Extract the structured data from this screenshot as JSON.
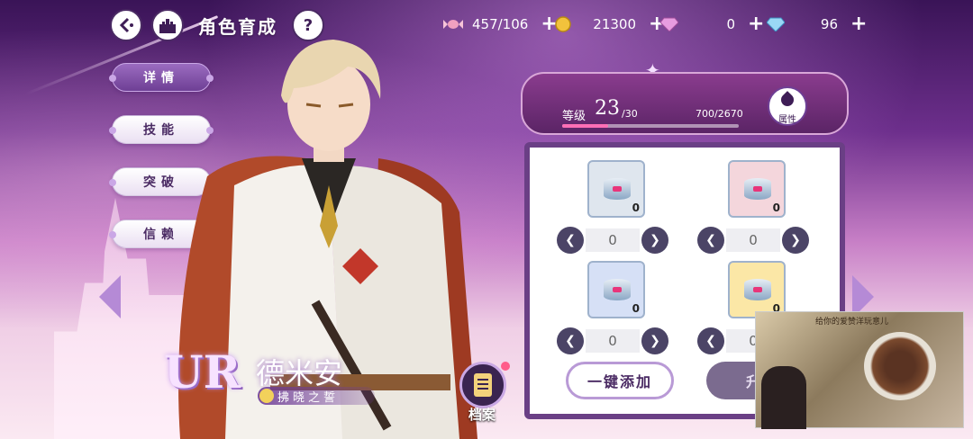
{
  "header": {
    "back_icon": "back-arrow-icon",
    "home_icon": "castle-home-icon",
    "title": "角色育成",
    "help_label": "?"
  },
  "currencies": [
    {
      "icon": "candy-icon",
      "value": "457/106",
      "plus": "+"
    },
    {
      "icon": "gold-coin-icon",
      "value": "21300",
      "plus": "+"
    },
    {
      "icon": "pink-gem-icon",
      "value": "0",
      "plus": "+"
    },
    {
      "icon": "blue-diamond-icon",
      "value": "96",
      "plus": "+"
    }
  ],
  "side_menu": [
    {
      "label": "详情",
      "active": true
    },
    {
      "label": "技能",
      "active": false
    },
    {
      "label": "突破",
      "active": false
    },
    {
      "label": "信赖",
      "active": false
    }
  ],
  "character": {
    "rarity": "UR",
    "name": "德米安",
    "title": "拂晓之誓",
    "archive_label": "档案"
  },
  "level": {
    "label": "等级",
    "value": "23",
    "max": "/30",
    "exp": "700/2670",
    "exp_fraction": 0.262,
    "attr_label": "属性"
  },
  "items": [
    {
      "qty": "0",
      "selected": "0",
      "color": "#dfe6ee"
    },
    {
      "qty": "0",
      "selected": "0",
      "color": "#f4d6dc"
    },
    {
      "qty": "0",
      "selected": "0",
      "color": "#d6e0f6"
    },
    {
      "qty": "0",
      "selected": "0",
      "color": "#fbe7a6"
    }
  ],
  "buttons": {
    "one_click": "一键添加",
    "upgrade": "升"
  },
  "video_overlay": {
    "caption": "给你的爱赞洋玩意儿"
  },
  "colors": {
    "accent_purple": "#6a3f85",
    "exp_bar": "#ff6fb6"
  }
}
